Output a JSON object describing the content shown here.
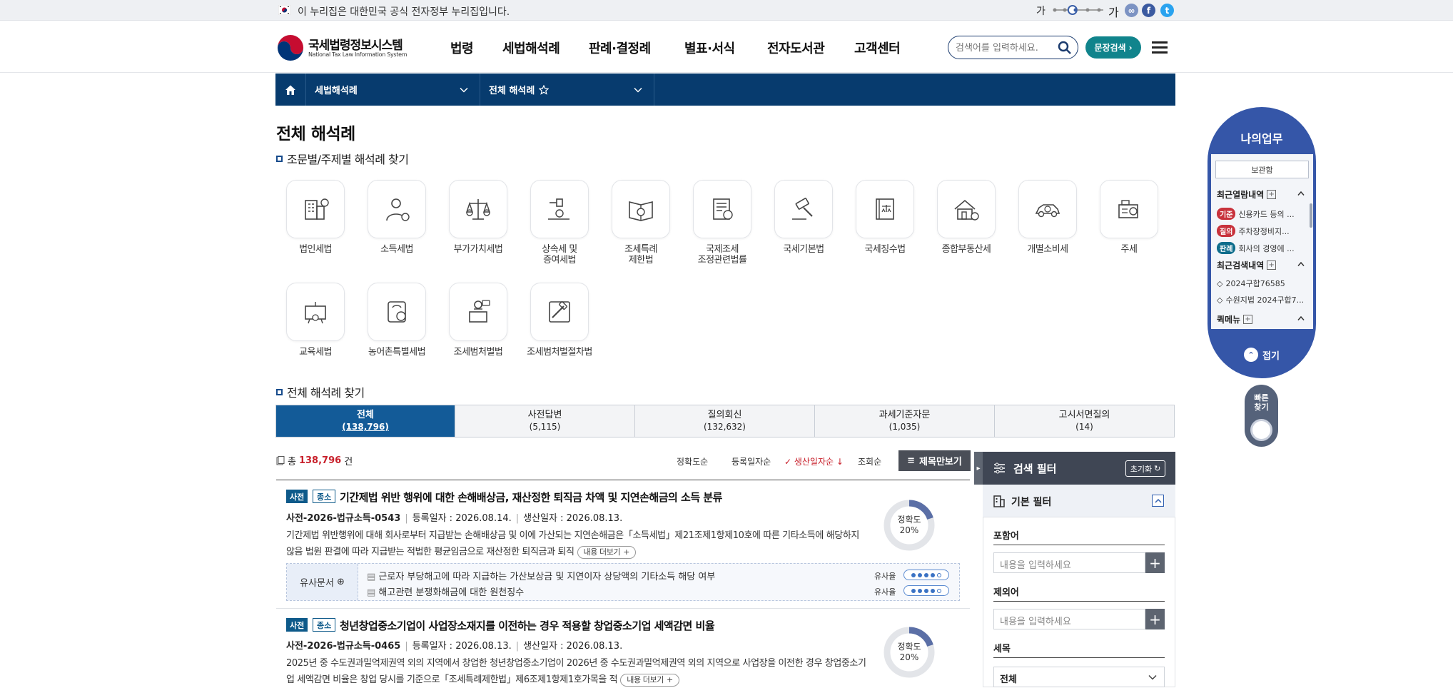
{
  "topbar": {
    "gov_notice": "이 누리집은 대한민국 공식 전자정부 누리집입니다.",
    "font_small": "가",
    "font_large": "가",
    "font_level": 0.4
  },
  "header": {
    "logo_title": "국세법령정보시스템",
    "logo_subtitle": "National Tax Law Information System",
    "nav": [
      "법령",
      "세법해석례",
      "판례·결정례",
      "별표·서식",
      "전자도서관",
      "고객센터"
    ],
    "search_placeholder": "검색어를 입력하세요.",
    "doc_search_label": "문장검색"
  },
  "lnb": {
    "menu1": "세법해석례",
    "menu2": "전체 해석례"
  },
  "page_title": "전체 해석례",
  "section1_title": "조문별/주제별 해석례 찾기",
  "categories": [
    "법인세법",
    "소득세법",
    "부가가치세법",
    "상속세 및\n증여세법",
    "조세특례\n제한법",
    "국제조세\n조정관련법률",
    "국세기본법",
    "국세징수법",
    "종합부동산세",
    "개별소비세",
    "주세",
    "교육세법",
    "농어촌특별세법",
    "조세범처벌법",
    "조세범처벌절차법"
  ],
  "section2_title": "전체 해석례 찾기",
  "tabs": [
    {
      "label": "전체",
      "count": "(138,796)"
    },
    {
      "label": "사전답변",
      "count": "(5,115)"
    },
    {
      "label": "질의회신",
      "count": "(132,632)"
    },
    {
      "label": "과세기준자문",
      "count": "(1,035)"
    },
    {
      "label": "고시서면질의",
      "count": "(14)"
    }
  ],
  "results": {
    "total_prefix": "총",
    "total_count": "138,796",
    "total_suffix": "건",
    "sort_options": [
      "정확도순",
      "등록일자순",
      "생산일자순",
      "조회순"
    ],
    "title_only_label": "제목만보기"
  },
  "docs": [
    {
      "badge1": "사전",
      "badge2": "종소",
      "title": "기간제법 위반 행위에 대한 손해배상금, 재산정한 퇴직금 차액 및 지연손해금의 소득 분류",
      "doc_no": "사전-2026-법규소득-0543",
      "reg_date": "등록일자 : 2026.08.14.",
      "prod_date": "생산일자 : 2026.08.13.",
      "summary": "기간제법 위반행위에 대해 회사로부터 지급받는 손해배상금 및 이에 가산되는 지연손해금은「소득세법」제21조제1항제10호에 따른 기타소득에 해당하지 않음 법원 판결에 따라 지급받는 적법한 평균임금으로 재산정한 퇴직금과 퇴직",
      "more_label": "내용 더보기",
      "accuracy_label": "정확도",
      "accuracy": "20%",
      "accuracy_value": 0.2,
      "similar_label": "유사문서",
      "similar": [
        {
          "text": "근로자 부당해고에 따라 지급하는 가산보상금 및 지연이자 상당액의 기타소득 해당 여부",
          "rate_label": "유사율",
          "level": 4
        },
        {
          "text": "해고관련 분쟁화해금에 대한 원천징수",
          "rate_label": "유사율",
          "level": 4
        }
      ]
    },
    {
      "badge1": "사전",
      "badge2": "종소",
      "title": "청년창업중소기업이 사업장소재지를 이전하는 경우 적용할 창업중소기업 세액감면 비율",
      "doc_no": "사전-2026-법규소득-0465",
      "reg_date": "등록일자 : 2026.08.13.",
      "prod_date": "생산일자 : 2026.08.13.",
      "summary": "2025년 중 수도권과밀억제권역 외의 지역에서 창업한 청년창업중소기업이 2026년 중 수도권과밀억제권역 외의 지역으로 사업장을 이전한 경우 창업중소기업 세액감면 비율은 창업 당시를 기준으로「조세특례제한법」제6조제1항제1호가목을 적",
      "more_label": "내용 더보기",
      "accuracy_label": "정확도",
      "accuracy": "20%",
      "accuracy_value": 0.2
    }
  ],
  "filter": {
    "title": "검색 필터",
    "reset_label": "초기화",
    "basic_title": "기본 필터",
    "include_label": "포함어",
    "include_placeholder": "내용을 입력하세요",
    "exclude_label": "제외어",
    "exclude_placeholder": "내용을 입력하세요",
    "tax_label": "세목",
    "tax_value": "전체"
  },
  "mywork": {
    "title": "나의업무",
    "archive_label": "보관함",
    "recent_view_title": "최근열람내역",
    "recent_views": [
      {
        "tag": "기준",
        "color": "#c8323c",
        "text": "신용카드 등의 ..."
      },
      {
        "tag": "질의",
        "color": "#c8323c",
        "text": "주차장정비지..."
      },
      {
        "tag": "판례",
        "color": "#0e6d8c",
        "text": "회사의 경영에 ..."
      }
    ],
    "recent_search_title": "최근검색내역",
    "recent_searches": [
      "2024구합76585",
      "수원지법 2024구합7..."
    ],
    "quick_menu_title": "퀵메뉴",
    "fold_label": "접기"
  },
  "quick_find": {
    "label": "빠른\n찾기"
  },
  "colors": {
    "navy": "#073b6e",
    "tab_active": "#135b98",
    "accent_red": "#c8202b",
    "teal": "#10848c",
    "mywork_blue": "#3556a8"
  }
}
